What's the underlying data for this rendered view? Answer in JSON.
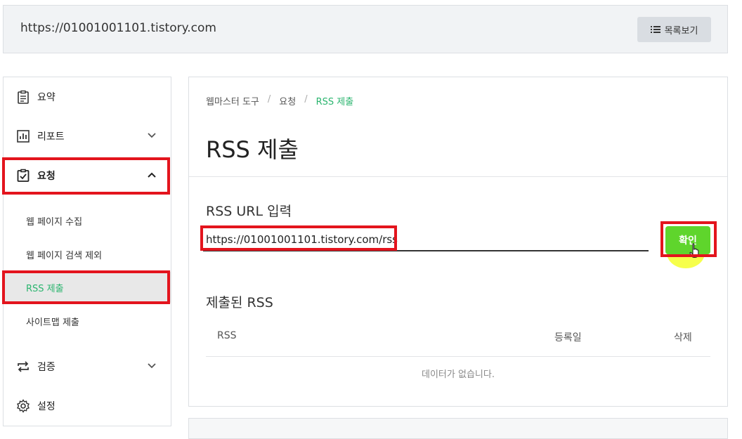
{
  "topbar": {
    "site_url": "https://01001001101.tistory.com",
    "list_button_label": "목록보기"
  },
  "sidebar": {
    "items": [
      {
        "label": "요약",
        "icon": "clipboard-icon"
      },
      {
        "label": "리포트",
        "icon": "bar-chart-icon",
        "chevron": "down"
      },
      {
        "label": "요청",
        "icon": "checklist-icon",
        "chevron": "up"
      },
      {
        "label": "검증",
        "icon": "swap-arrows-icon",
        "chevron": "down"
      },
      {
        "label": "설정",
        "icon": "gear-icon"
      }
    ],
    "sub_items": [
      {
        "label": "웹 페이지 수집"
      },
      {
        "label": "웹 페이지 검색 제외"
      },
      {
        "label": "RSS 제출"
      },
      {
        "label": "사이트맵 제출"
      }
    ]
  },
  "breadcrumb": {
    "items": [
      "웹마스터 도구",
      "요청",
      "RSS 제출"
    ],
    "separator": "/"
  },
  "main": {
    "title": "RSS 제출",
    "input_label": "RSS URL 입력",
    "input_value": "https://01001001101.tistory.com/rss",
    "confirm_label": "확인",
    "submitted_label": "제출된 RSS",
    "table_headers": [
      "RSS",
      "등록일",
      "삭제"
    ],
    "empty_message": "데이터가 없습니다."
  },
  "colors": {
    "accent_green": "#2bb56f",
    "button_green": "#5fd52c",
    "highlight_red": "#e3141d",
    "cursor_glow": "#f4ff2c"
  }
}
